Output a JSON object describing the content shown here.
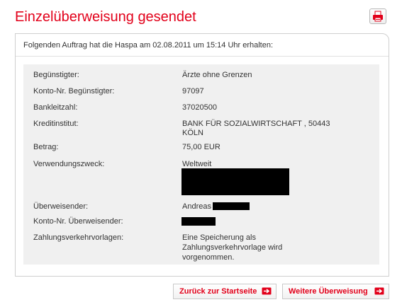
{
  "page": {
    "title": "Einzelüberweisung gesendet"
  },
  "toolbar": {
    "print_icon": "printer-icon"
  },
  "confirmation": {
    "intro_text": "Folgenden Auftrag hat die Haspa am 02.08.2011 um 15:14 Uhr erhalten:"
  },
  "details": [
    {
      "label": "Begünstigter:",
      "value": "Ärzte ohne Grenzen"
    },
    {
      "label": "Konto-Nr. Begünstigter:",
      "value": "97097"
    },
    {
      "label": "Bankleitzahl:",
      "value": "37020500"
    },
    {
      "label": "Kreditinstitut:",
      "value": "BANK FÜR SOZIALWIRTSCHAFT , 50443",
      "value_line2": "KÖLN"
    },
    {
      "label": "Betrag:",
      "value": "75,00  EUR"
    },
    {
      "label": "Verwendungszweck:",
      "value": "Weltweit"
    },
    {
      "label": "Überweisender:",
      "value": "Andreas"
    },
    {
      "label": "Konto-Nr. Überweisender:",
      "value": ""
    },
    {
      "label": "Zahlungsverkehrvorlagen:",
      "value": "Eine Speicherung als",
      "value_line2": "Zahlungsverkehrvorlage wird",
      "value_line3": "vorgenommen."
    }
  ],
  "actions": {
    "back_label": "Zurück zur Startseite",
    "further_label": "Weitere Überweisung",
    "arrow_icon": "arrow-right-icon"
  },
  "colors": {
    "brand_red": "#e2001a",
    "panel_background": "#f0f0f0",
    "redaction": "#000000"
  }
}
